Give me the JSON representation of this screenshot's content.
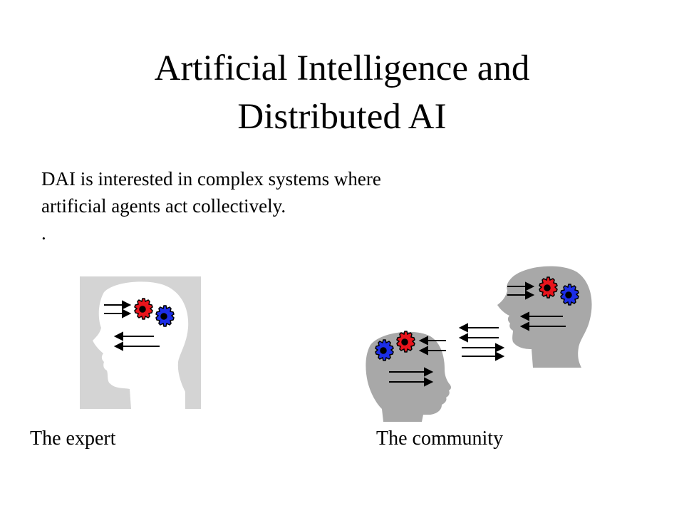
{
  "slide": {
    "title_lines": [
      "Artificial Intelligence and",
      "Distributed AI"
    ],
    "body_lines": [
      "DAI is interested in complex systems where",
      "artificial agents act collectively.",
      "."
    ]
  },
  "figures": {
    "expert": {
      "caption": "The expert",
      "icon": "head-with-gears-icon"
    },
    "community": {
      "caption": "The community",
      "icon": "two-heads-communicating-icon"
    }
  },
  "colors": {
    "gear_red": "#e8141c",
    "gear_blue": "#1c2ee8",
    "head_gray": "#c0c0c0",
    "head_dark_gray": "#a8a8a8",
    "panel_light_gray": "#d4d4d4"
  }
}
